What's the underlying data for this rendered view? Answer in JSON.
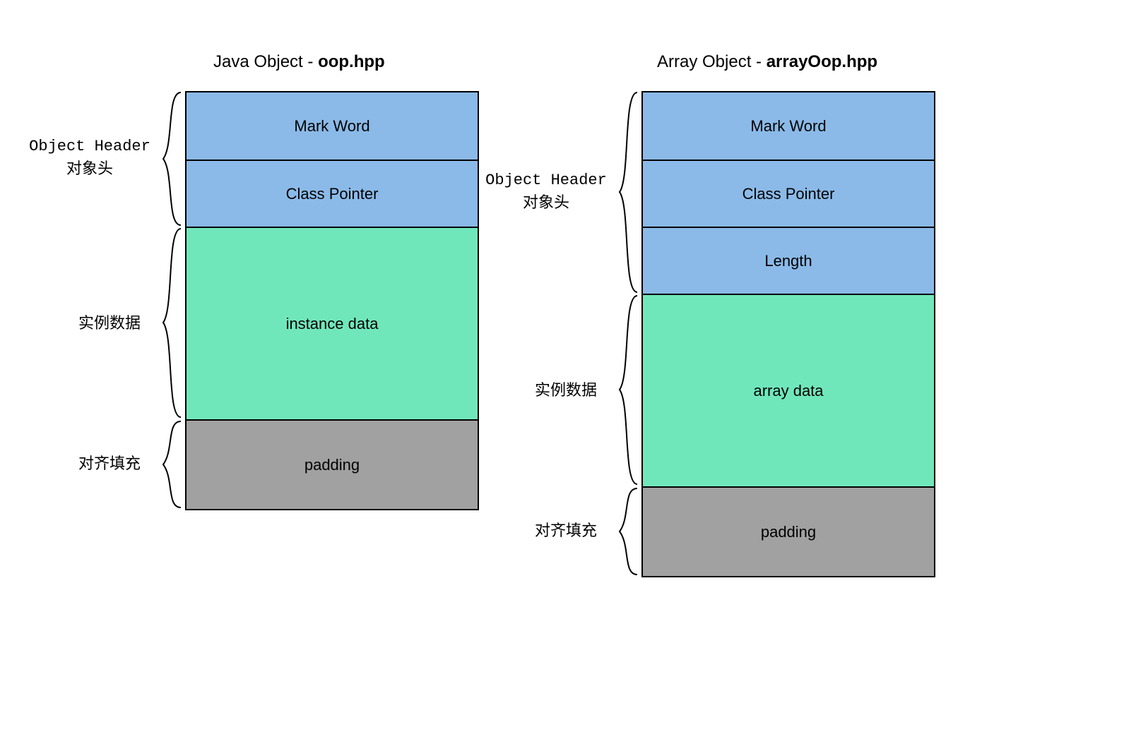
{
  "colors": {
    "blue": "#8bbae8",
    "green": "#70e7bb",
    "gray": "#a1a1a1"
  },
  "left": {
    "title_prefix": "Java Object - ",
    "title_bold": "oop.hpp",
    "header_label_en": "Object Header",
    "header_label_cn": "对象头",
    "instance_label": "实例数据",
    "padding_label": "对齐填充",
    "cells": {
      "mark": "Mark Word",
      "classptr": "Class Pointer",
      "instance": "instance data",
      "padding": "padding"
    }
  },
  "right": {
    "title_prefix": "Array Object - ",
    "title_bold": "arrayOop.hpp",
    "header_label_en": "Object Header",
    "header_label_cn": "对象头",
    "instance_label": "实例数据",
    "padding_label": "对齐填充",
    "cells": {
      "mark": "Mark Word",
      "classptr": "Class Pointer",
      "length": "Length",
      "array": "array data",
      "padding": "padding"
    }
  }
}
